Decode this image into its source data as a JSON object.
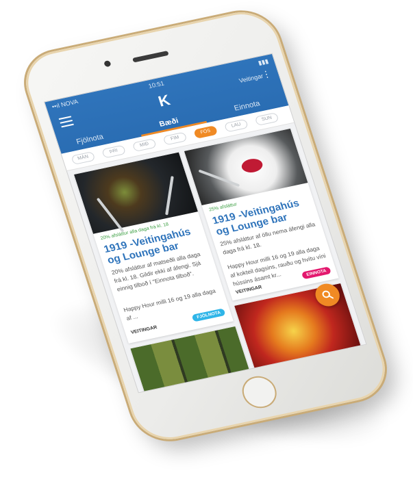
{
  "status_bar": {
    "carrier": "••ıl NOVA",
    "time": "10:51"
  },
  "header": {
    "tab_right_label": "Veitingar",
    "logo": "K"
  },
  "tabs": [
    {
      "label": "Fjölnota",
      "active": false
    },
    {
      "label": "Bæði",
      "active": true
    },
    {
      "label": "Einnota",
      "active": false
    }
  ],
  "days": [
    {
      "label": "MÁN",
      "active": false
    },
    {
      "label": "ÞRI",
      "active": false
    },
    {
      "label": "MIÐ",
      "active": false
    },
    {
      "label": "FIM",
      "active": false
    },
    {
      "label": "FÖS",
      "active": true
    },
    {
      "label": "LAU",
      "active": false
    },
    {
      "label": "SUN",
      "active": false
    }
  ],
  "cards": [
    {
      "discount": "20% afsláttur alla daga frá kl. 18",
      "title": "1919 -Veitingahús og Lounge bar",
      "description": "20% afsláttur af matseðli alla daga frá kl. 18. Gildir ekki af áfengi. Sjá einnig tilboð í \"Einnota tilboð\".",
      "description2": "Happy Hour milli 16 og 19 alla daga af ...",
      "category": "VEITINGAR",
      "badge": "FJÖLNOTA"
    },
    {
      "discount": "25% afsláttur",
      "title": "1919 -Veitingahús og Lounge bar",
      "description": "25% afsláttur af öllu nema áfengi alla daga frá kl. 18.",
      "description2": "Happy Hour milli 16 og 19 alla daga af kokteil dagsins, rauðu og hvítu víni hússins ásamt kr...",
      "category": "VEITINGAR",
      "badge": "EINNOTA"
    }
  ],
  "colors": {
    "primary": "#2f74bb",
    "accent": "#f08a24",
    "fjolnota": "#2fb5e8",
    "einnota": "#e3186e"
  }
}
